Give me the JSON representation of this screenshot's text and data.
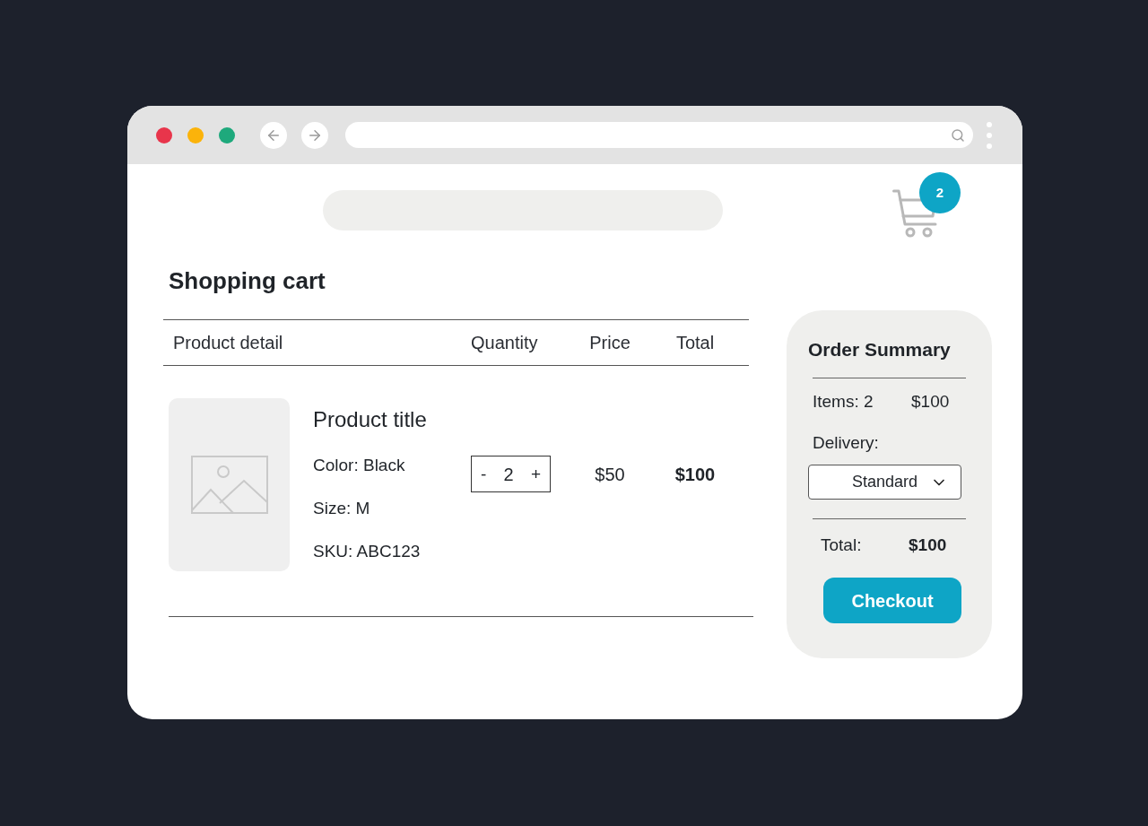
{
  "browser": {
    "window_controls": [
      {
        "color": "#e8354b"
      },
      {
        "color": "#fbb30a"
      },
      {
        "color": "#1ea97c"
      }
    ]
  },
  "header": {
    "cart_count": "2"
  },
  "cart": {
    "title": "Shopping cart",
    "columns": [
      "Product detail",
      "Quantity",
      "Price",
      "Total"
    ],
    "items": [
      {
        "title": "Product title",
        "attributes": [
          "Color: Black",
          "Size: M",
          "SKU: ABC123"
        ],
        "quantity": {
          "decrement": "-",
          "value": "2",
          "increment": "+"
        },
        "price": "$50",
        "total": "$100"
      }
    ]
  },
  "summary": {
    "title": "Order Summary",
    "items_label": "Items: 2",
    "items_amount": "$100",
    "delivery_label": "Delivery:",
    "delivery_option": "Standard",
    "total_label": "Total:",
    "total_amount": "$100",
    "checkout_label": "Checkout"
  }
}
